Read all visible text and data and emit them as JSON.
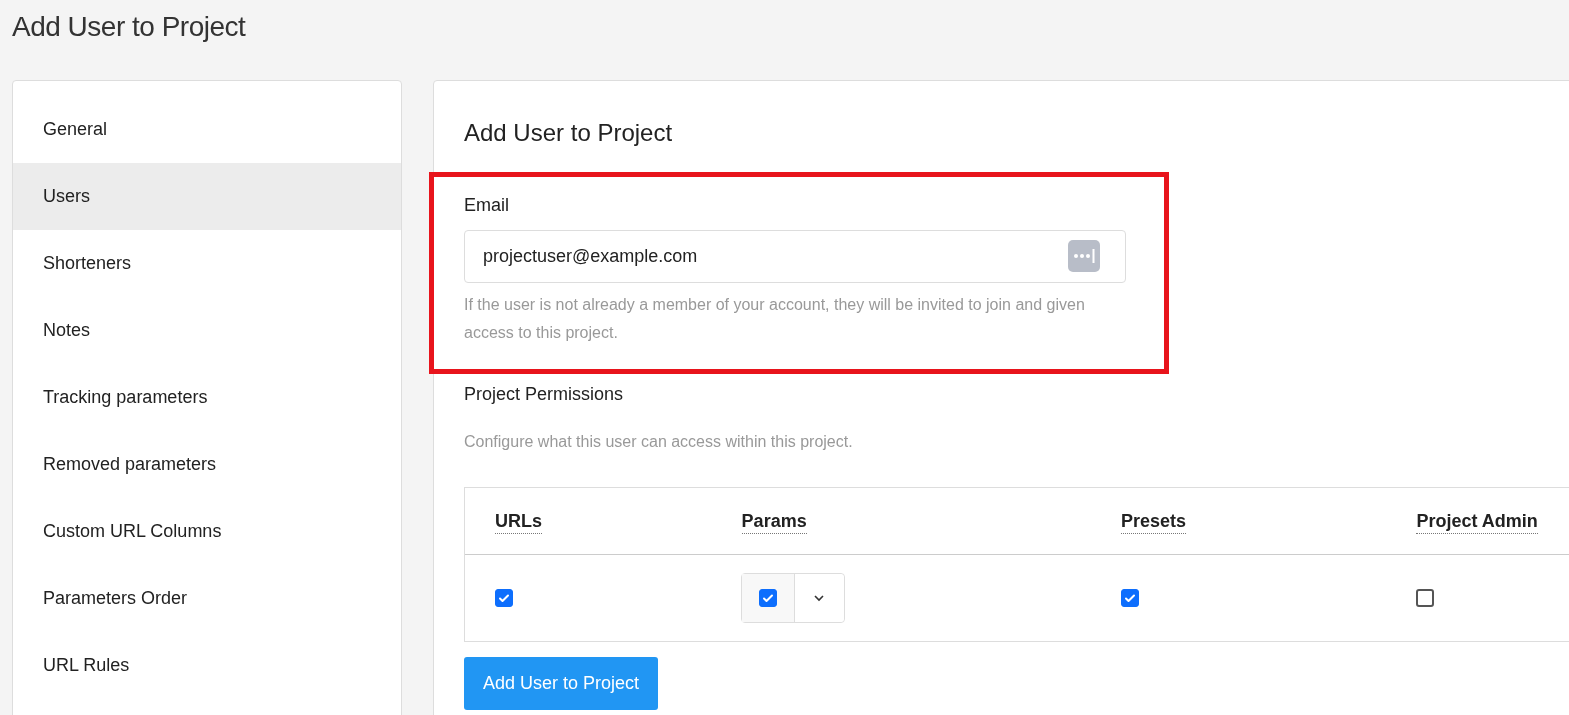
{
  "page_title": "Add User to Project",
  "sidebar": {
    "items": [
      {
        "label": "General",
        "selected": false
      },
      {
        "label": "Users",
        "selected": true
      },
      {
        "label": "Shorteners",
        "selected": false
      },
      {
        "label": "Notes",
        "selected": false
      },
      {
        "label": "Tracking parameters",
        "selected": false
      },
      {
        "label": "Removed parameters",
        "selected": false
      },
      {
        "label": "Custom URL Columns",
        "selected": false
      },
      {
        "label": "Parameters Order",
        "selected": false
      },
      {
        "label": "URL Rules",
        "selected": false
      }
    ]
  },
  "form": {
    "heading": "Add User to Project",
    "email": {
      "label": "Email",
      "value": "projectuser@example.com",
      "help": "If the user is not already a member of your account, they will be invited to join and given access to this project.",
      "highlighted": true
    },
    "permissions": {
      "label": "Project Permissions",
      "description": "Configure what this user can access within this project.",
      "columns": [
        "URLs",
        "Params",
        "Presets",
        "Project Admin"
      ],
      "rows": [
        {
          "cells": [
            {
              "kind": "checkbox",
              "checked": true
            },
            {
              "kind": "dropdown-checkbox",
              "checked": true
            },
            {
              "kind": "checkbox",
              "checked": true
            },
            {
              "kind": "checkbox",
              "checked": false
            }
          ]
        }
      ]
    },
    "submit_button": "Add User to Project"
  }
}
